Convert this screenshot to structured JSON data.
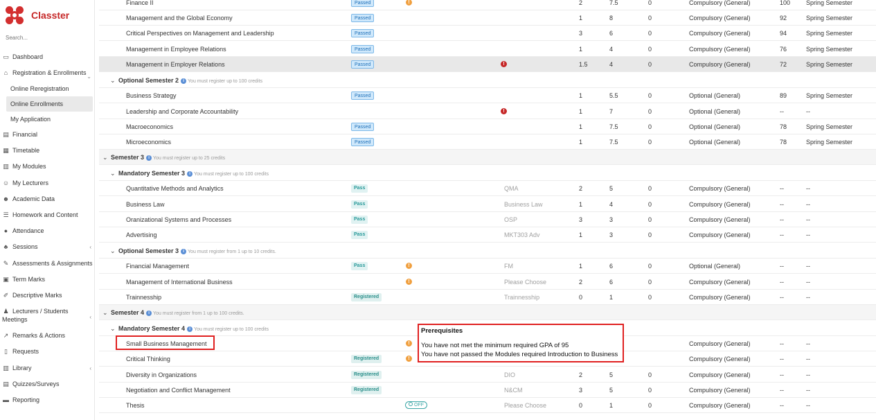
{
  "app": {
    "name": "Classter"
  },
  "sidebar": {
    "search_placeholder": "Search...",
    "items": [
      {
        "label": "Dashboard",
        "icon": "monitor-icon"
      },
      {
        "label": "Registration & Enrollments",
        "icon": "institution-icon"
      },
      {
        "label": "Online Reregistration"
      },
      {
        "label": "Online Enrollments"
      },
      {
        "label": "My Application"
      },
      {
        "label": "Financial",
        "icon": "money-icon"
      },
      {
        "label": "Timetable",
        "icon": "table-icon"
      },
      {
        "label": "My Modules",
        "icon": "books-icon"
      },
      {
        "label": "My Lecturers",
        "icon": "users-icon"
      },
      {
        "label": "Academic Data",
        "icon": "user-data-icon"
      },
      {
        "label": "Homework and Content",
        "icon": "list-icon"
      },
      {
        "label": "Attendance",
        "icon": "person-icon"
      },
      {
        "label": "Sessions",
        "icon": "group-icon"
      },
      {
        "label": "Assessments & Assignments",
        "icon": "edit-icon"
      },
      {
        "label": "Term Marks",
        "icon": "calendar-icon"
      },
      {
        "label": "Descriptive Marks",
        "icon": "edit-doc-icon"
      },
      {
        "label": "Lecturers / Students",
        "label2": "Meetings",
        "icon": "meeting-icon"
      },
      {
        "label": "Remarks & Actions",
        "icon": "chart-icon"
      },
      {
        "label": "Requests",
        "icon": "doc-icon"
      },
      {
        "label": "Library",
        "icon": "library-icon"
      },
      {
        "label": "Quizzes/Surveys",
        "icon": "quiz-icon"
      },
      {
        "label": "Reporting",
        "icon": "printer-icon"
      }
    ]
  },
  "headers": {
    "optional_sem2": {
      "title": "Optional Semester 2",
      "note": "You must register up to 100 credits"
    },
    "semester3": {
      "title": "Semester 3",
      "note": "You must register up to 25 credits"
    },
    "mandatory_sem3": {
      "title": "Mandatory Semester 3",
      "note": "You must register up to 100 credits"
    },
    "optional_sem3": {
      "title": "Optional Semester 3",
      "note": "You must register from 1 up to 10 credits."
    },
    "semester4": {
      "title": "Semester 4",
      "note": "You must register from 1 up to 100 credits."
    },
    "mandatory_sem4": {
      "title": "Mandatory Semester 4",
      "note": "You must register up to 100 credits"
    }
  },
  "rows": [
    {
      "name": "Finance II",
      "badge": "Passed",
      "warn": true,
      "n1": "2",
      "n2": "7.5",
      "n3": "0",
      "type": "Compulsory (General)",
      "grade": "100",
      "period": "Spring Semester"
    },
    {
      "name": "Management and the Global Economy",
      "badge": "Passed",
      "n1": "1",
      "n2": "8",
      "n3": "0",
      "type": "Compulsory (General)",
      "grade": "92",
      "period": "Spring Semester"
    },
    {
      "name": "Critical Perspectives on Management and Leadership",
      "badge": "Passed",
      "n1": "3",
      "n2": "6",
      "n3": "0",
      "type": "Compulsory (General)",
      "grade": "94",
      "period": "Spring Semester"
    },
    {
      "name": "Management in Employee Relations",
      "badge": "Passed",
      "n1": "1",
      "n2": "4",
      "n3": "0",
      "type": "Compulsory (General)",
      "grade": "76",
      "period": "Spring Semester"
    },
    {
      "name": "Management in Employer Relations",
      "badge": "Passed",
      "err": true,
      "n1": "1.5",
      "n2": "4",
      "n3": "0",
      "type": "Compulsory (General)",
      "grade": "72",
      "period": "Spring Semester"
    },
    {
      "name": "Business Strategy",
      "badge": "Passed",
      "n1": "1",
      "n2": "5.5",
      "n3": "0",
      "type": "Optional (General)",
      "grade": "89",
      "period": "Spring Semester"
    },
    {
      "name": "Leadership and Corporate Accountability",
      "err": true,
      "n1": "1",
      "n2": "7",
      "n3": "0",
      "type": "Optional (General)",
      "grade": "--",
      "period": "--"
    },
    {
      "name": "Macroeconomics",
      "badge": "Passed",
      "n1": "1",
      "n2": "7.5",
      "n3": "0",
      "type": "Optional (General)",
      "grade": "78",
      "period": "Spring Semester"
    },
    {
      "name": "Microeconomics",
      "badge": "Passed",
      "n1": "1",
      "n2": "7.5",
      "n3": "0",
      "type": "Optional (General)",
      "grade": "78",
      "period": "Spring Semester"
    },
    {
      "name": "Quantitative Methods and Analytics",
      "badge": "Pass",
      "code": "QMA",
      "n1": "2",
      "n2": "5",
      "n3": "0",
      "type": "Compulsory (General)",
      "grade": "--",
      "period": "--"
    },
    {
      "name": "Business Law",
      "badge": "Pass",
      "code": "Business Law",
      "n1": "1",
      "n2": "4",
      "n3": "0",
      "type": "Compulsory (General)",
      "grade": "--",
      "period": "--"
    },
    {
      "name": "Oranizational Systems and Processes",
      "badge": "Pass",
      "code": "OSP",
      "n1": "3",
      "n2": "3",
      "n3": "0",
      "type": "Compulsory (General)",
      "grade": "--",
      "period": "--"
    },
    {
      "name": "Advertising",
      "badge": "Pass",
      "code": "MKT303 Adv",
      "n1": "1",
      "n2": "3",
      "n3": "0",
      "type": "Compulsory (General)",
      "grade": "--",
      "period": "--"
    },
    {
      "name": "Financial Management",
      "badge": "Pass",
      "warn": true,
      "code": "FM",
      "n1": "1",
      "n2": "6",
      "n3": "0",
      "type": "Optional (General)",
      "grade": "--",
      "period": "--"
    },
    {
      "name": "Management of International Business",
      "warn": true,
      "code": "Please Choose",
      "n1": "2",
      "n2": "6",
      "n3": "0",
      "type": "Compulsory (General)",
      "grade": "--",
      "period": "--"
    },
    {
      "name": "Trainnesship",
      "badge": "Registered",
      "code": "Trainnesship",
      "n1": "0",
      "n2": "1",
      "n3": "0",
      "type": "Compulsory (General)",
      "grade": "--",
      "period": "--"
    },
    {
      "name": "Small Business Management",
      "warn": true,
      "type": "Compulsory (General)",
      "grade": "--",
      "period": "--"
    },
    {
      "name": "Critical Thinking",
      "badge": "Registered",
      "warn": true,
      "type": "Compulsory (General)",
      "grade": "--",
      "period": "--"
    },
    {
      "name": "Diversity in Organizations",
      "badge": "Registered",
      "code": "DIO",
      "n1": "2",
      "n2": "5",
      "n3": "0",
      "type": "Compulsory (General)",
      "grade": "--",
      "period": "--"
    },
    {
      "name": "Negotiation and Conflict Management",
      "badge": "Registered",
      "code": "N&CM",
      "n1": "3",
      "n2": "5",
      "n3": "0",
      "type": "Compulsory (General)",
      "grade": "--",
      "period": "--"
    },
    {
      "name": "Thesis",
      "toggle": "OFF",
      "code": "Please Choose",
      "n1": "0",
      "n2": "1",
      "n3": "0",
      "type": "Compulsory (General)",
      "grade": "--",
      "period": "--"
    }
  ],
  "tooltip": {
    "title": "Prerequisites",
    "line1": "You have not met the minimum required GPA of 95",
    "line2": "You have not passed the Modules required Introduction to Business"
  },
  "icons": {
    "warning": "!",
    "error": "!",
    "info": "i"
  }
}
